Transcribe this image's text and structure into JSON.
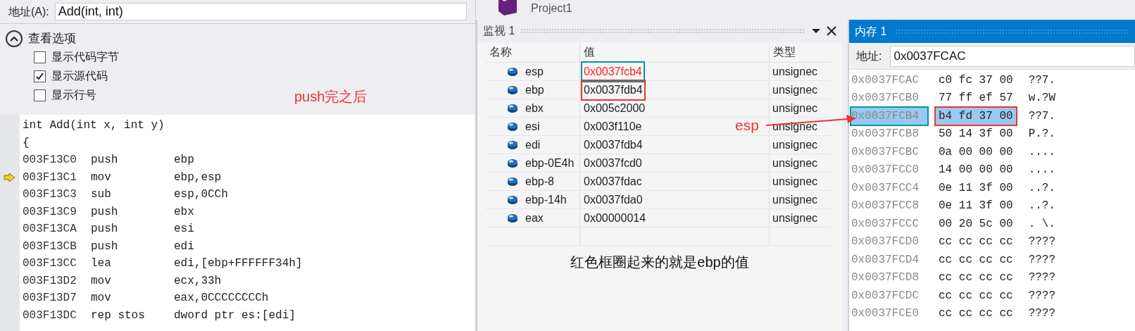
{
  "disassembly": {
    "address_label": "地址(A):",
    "address_value": "Add(int, int)",
    "options": {
      "title": "查看选项",
      "expanded": true,
      "items": [
        {
          "label": "显示代码字节",
          "checked": false
        },
        {
          "label": "显示源代码",
          "checked": true
        },
        {
          "label": "显示行号",
          "checked": false
        }
      ]
    },
    "note": "push完之后",
    "lines": [
      {
        "kind": "source",
        "text": "int Add(int x, int y)",
        "current": false
      },
      {
        "kind": "source",
        "text": "{",
        "current": false
      },
      {
        "kind": "asm",
        "addr": "003F13C0",
        "op": "push",
        "args": "ebp",
        "current": false
      },
      {
        "kind": "asm",
        "addr": "003F13C1",
        "op": "mov",
        "args": "ebp,esp",
        "current": true
      },
      {
        "kind": "asm",
        "addr": "003F13C3",
        "op": "sub",
        "args": "esp,0CCh",
        "current": false
      },
      {
        "kind": "asm",
        "addr": "003F13C9",
        "op": "push",
        "args": "ebx",
        "current": false
      },
      {
        "kind": "asm",
        "addr": "003F13CA",
        "op": "push",
        "args": "esi",
        "current": false
      },
      {
        "kind": "asm",
        "addr": "003F13CB",
        "op": "push",
        "args": "edi",
        "current": false
      },
      {
        "kind": "asm",
        "addr": "003F13CC",
        "op": "lea",
        "args": "edi,[ebp+FFFFFF34h]",
        "current": false
      },
      {
        "kind": "asm",
        "addr": "003F13D2",
        "op": "mov",
        "args": "ecx,33h",
        "current": false
      },
      {
        "kind": "asm",
        "addr": "003F13D7",
        "op": "mov",
        "args": "eax,0CCCCCCCCh",
        "current": false
      },
      {
        "kind": "asm",
        "addr": "003F13DC",
        "op": "rep stos",
        "args": "dword ptr es:[edi]",
        "current": false
      }
    ]
  },
  "project_title": "Project1",
  "watch": {
    "title": "监视 1",
    "columns": [
      "名称",
      "值",
      "类型"
    ],
    "rows": [
      {
        "name": "esp",
        "value": "0x0037fcb4",
        "type": "unsignec",
        "changed": true,
        "color": "#009999"
      },
      {
        "name": "ebp",
        "value": "0x0037fdb4",
        "type": "unsignec",
        "changed": false,
        "color": "#ee3333"
      },
      {
        "name": "ebx",
        "value": "0x005c2000",
        "type": "unsignec",
        "changed": false
      },
      {
        "name": "esi",
        "value": "0x003f110e",
        "type": "unsignec",
        "changed": false
      },
      {
        "name": "edi",
        "value": "0x0037fdb4",
        "type": "unsignec",
        "changed": false
      },
      {
        "name": "ebp-0E4h",
        "value": "0x0037fcd0",
        "type": "unsignec",
        "changed": false
      },
      {
        "name": "ebp-8",
        "value": "0x0037fdac",
        "type": "unsignec",
        "changed": false
      },
      {
        "name": "ebp-14h",
        "value": "0x0037fda0",
        "type": "unsignec",
        "changed": false
      },
      {
        "name": "eax",
        "value": "0x00000014",
        "type": "unsignec",
        "changed": false
      }
    ],
    "caption": "红色框圈起来的就是ebp的值"
  },
  "arrow_label": "esp",
  "memory": {
    "title": "内存 1",
    "address_label": "地址:",
    "address_value": "0x0037FCAC",
    "rows": [
      {
        "address": "0x0037FCAC",
        "bytes": "c0 fc 37 00",
        "ascii": "??7.",
        "selected": false
      },
      {
        "address": "0x0037FCB0",
        "bytes": "77 ff ef 57",
        "ascii": "w.?W",
        "selected": false
      },
      {
        "address": "0x0037FCB4",
        "bytes": "b4 fd 37 00",
        "ascii": "??7.",
        "selected": true
      },
      {
        "address": "0x0037FCB8",
        "bytes": "50 14 3f 00",
        "ascii": "P.?.",
        "selected": false
      },
      {
        "address": "0x0037FCBC",
        "bytes": "0a 00 00 00",
        "ascii": "....",
        "selected": false
      },
      {
        "address": "0x0037FCC0",
        "bytes": "14 00 00 00",
        "ascii": "....",
        "selected": false
      },
      {
        "address": "0x0037FCC4",
        "bytes": "0e 11 3f 00",
        "ascii": "..?.",
        "selected": false
      },
      {
        "address": "0x0037FCC8",
        "bytes": "0e 11 3f 00",
        "ascii": "..?.",
        "selected": false
      },
      {
        "address": "0x0037FCCC",
        "bytes": "00 20 5c 00",
        "ascii": ". \\.",
        "selected": false
      },
      {
        "address": "0x0037FCD0",
        "bytes": "cc cc cc cc",
        "ascii": "????",
        "selected": false
      },
      {
        "address": "0x0037FCD4",
        "bytes": "cc cc cc cc",
        "ascii": "????",
        "selected": false
      },
      {
        "address": "0x0037FCD8",
        "bytes": "cc cc cc cc",
        "ascii": "????",
        "selected": false
      },
      {
        "address": "0x0037FCDC",
        "bytes": "cc cc cc cc",
        "ascii": "????",
        "selected": false
      },
      {
        "address": "0x0037FCE0",
        "bytes": "cc cc cc cc",
        "ascii": "????",
        "selected": false
      }
    ]
  }
}
